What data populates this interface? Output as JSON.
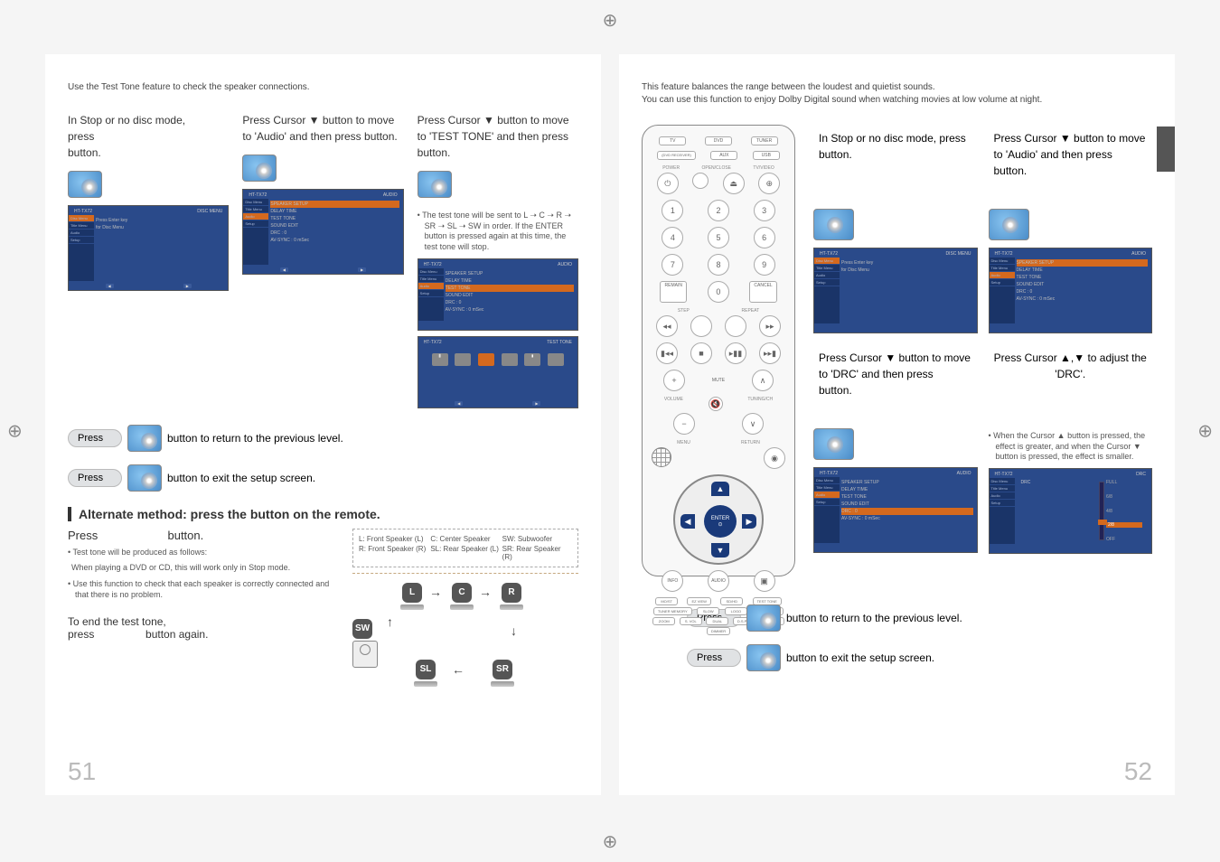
{
  "page_left": {
    "intro": "Use the Test Tone feature to check the speaker connections.",
    "step1": {
      "line1": "In Stop or no disc mode,",
      "line2": "press",
      "line3": "button."
    },
    "step2": {
      "line1": "Press Cursor ▼ button to move to 'Audio' and then press",
      "line2": "button."
    },
    "step3": {
      "line1": "Press Cursor ▼ button to move to 'TEST TONE' and then press",
      "line2": "button."
    },
    "note3": "• The test tone will be sent to L ➝ C ➝ R ➝ SR ➝ SL ➝ SW in order. If the ENTER button is pressed again at this time, the test tone will stop.",
    "press_return": {
      "pill": "Press",
      "text": "button to return to the previous level."
    },
    "press_exit": {
      "pill": "Press",
      "text": "button to exit the setup screen."
    },
    "subhead": "Alternate method: press the                    button on the remote.",
    "press_testtone": {
      "label": "Press",
      "suffix": "button."
    },
    "alt_bullets": [
      "• Test tone will be produced as follows:",
      "When playing a DVD or CD, this will work only in Stop mode.",
      "• Use this function to check that each speaker is correctly connected and that there is no problem."
    ],
    "end_tone": {
      "l1": "To end the test tone,",
      "l2": "press",
      "l3": "button again."
    },
    "legend": {
      "l": "L: Front Speaker (L)",
      "c": "C: Center Speaker",
      "sw": "SW: Subwoofer",
      "r": "R: Front Speaker (R)",
      "sl": "SL: Rear Speaker (L)",
      "sr": "SR: Rear Speaker (R)"
    },
    "screenshot_items": {
      "nav": [
        "Disc Menu",
        "Title Menu",
        "",
        "Audio",
        "",
        "Setup"
      ],
      "audio_title_l": "HT-TX72",
      "audio_title_r_disc": "DISC MENU",
      "audio_title_r_audio": "AUDIO",
      "disc_text": [
        "Press Enter key",
        "for Disc Menu"
      ],
      "audio_list": [
        "SPEAKER SETUP",
        "DELAY TIME",
        "TEST TONE",
        "SOUND EDIT",
        "DRC          : 0",
        "AV-SYNC   : 0 mSec"
      ],
      "testtone_title_r": "TEST TONE"
    },
    "diagram_labels": {
      "L": "L",
      "C": "C",
      "R": "R",
      "SW": "SW",
      "SL": "SL",
      "SR": "SR"
    },
    "page_num": "51"
  },
  "page_right": {
    "intro1": "This feature balances the range between the loudest and quietist sounds.",
    "intro2": "You can use this function to enjoy Dolby Digital sound when watching movies at low volume at night.",
    "step1": {
      "line1": "In Stop or no disc mode, press",
      "line2": "button."
    },
    "step2": {
      "line1": "Press Cursor ▼ button to move to 'Audio' and then press",
      "line2": "button."
    },
    "step3": {
      "line1": "Press Cursor ▼ button to move to 'DRC' and then press",
      "line2": "button."
    },
    "step4": {
      "line1": "Press Cursor ▲,▼ to adjust the 'DRC'."
    },
    "note4": "• When the Cursor ▲ button is pressed, the effect is greater, and when the Cursor ▼ button is pressed, the effect is smaller.",
    "press_return": {
      "pill": "Press",
      "text": "button to return to the previous level."
    },
    "press_exit": {
      "pill": "Press",
      "text": "button to exit the setup screen."
    },
    "remote": {
      "top": [
        "TV",
        "DVD",
        "TUNER"
      ],
      "top2": [
        "(DVD RECEIVER)",
        "AUX",
        "USB"
      ],
      "row_power": {
        "power": "POWER",
        "open": "OPEN/CLOSE",
        "tv": "TV/VIDEO"
      },
      "num": [
        "1",
        "2",
        "3",
        "4",
        "5",
        "6",
        "7",
        "8",
        "9",
        "REMAIN",
        "0",
        "CANCEL"
      ],
      "step_repeat": [
        "STEP",
        "REPEAT"
      ],
      "mute": "MUTE",
      "vol_tune": [
        "VOLUME",
        "TUNING/CH"
      ],
      "menu": "MENU",
      "return": "RETURN",
      "enter": "ENTER",
      "bottom_row": [
        "INFO",
        "",
        "AUDIO",
        "",
        ""
      ],
      "grid": [
        "MO/ST",
        "EZ VIEW",
        "SD/HD",
        "TEST TONE",
        "TUNER MEMORY",
        "SLOW",
        "LOGO",
        "SOUND EDIT",
        "ZOOM",
        "S. VOL",
        "DUAL",
        "D.S.P/EQ",
        "SLEEP",
        "DIMMER"
      ]
    },
    "screenshot_items": {
      "nav": [
        "Disc Menu",
        "Title Menu",
        "Function",
        "Audio",
        "",
        "Setup"
      ],
      "disc_title_r": "DISC MENU",
      "audio_title_r": "AUDIO",
      "drc_title_r": "DRC",
      "disc_text": [
        "Press Enter key",
        "for Disc Menu"
      ],
      "audio_list": [
        "SPEAKER SETUP",
        "DELAY TIME",
        "TEST TONE",
        "SOUND EDIT",
        "DRC          : 0",
        "AV-SYNC   : 0 mSec"
      ],
      "drc_scale": [
        "FULL",
        "6/8",
        "4/8",
        "2/8",
        "OFF"
      ]
    },
    "page_num": "52"
  }
}
